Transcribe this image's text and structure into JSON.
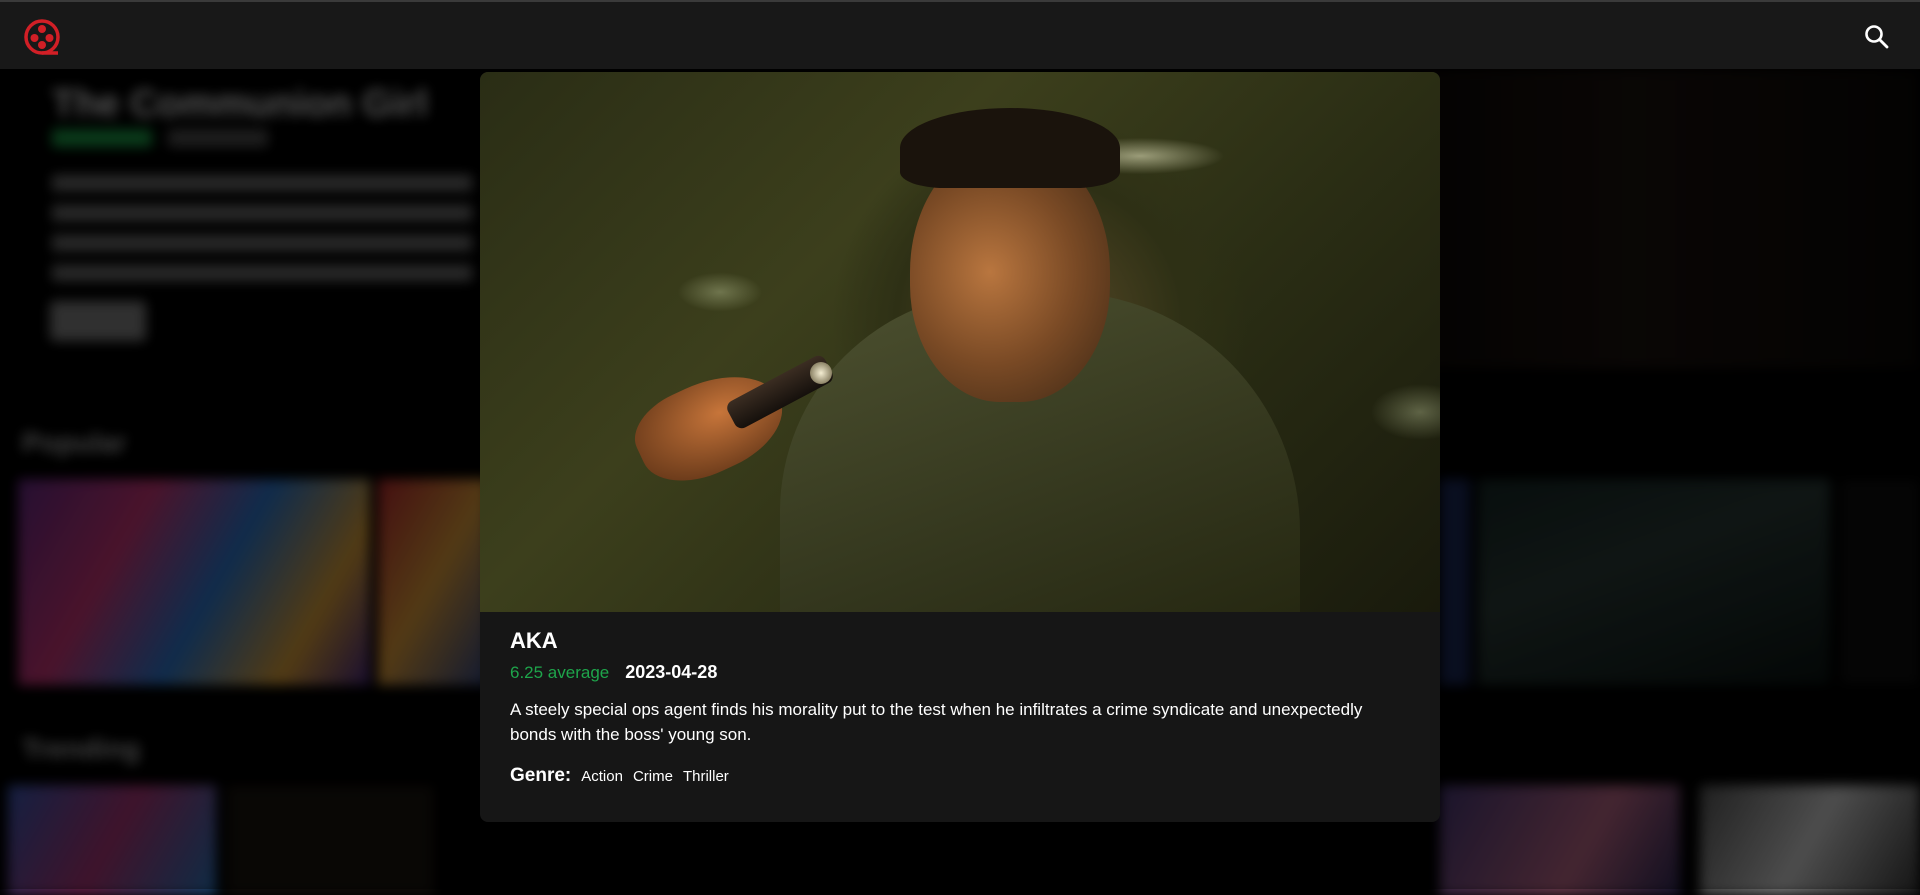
{
  "header": {
    "logo_icon": "film-reel-logo-icon",
    "search_icon": "search-icon",
    "accent_color": "#d21f26"
  },
  "modal": {
    "title": "AKA",
    "rating_text": "6.25 average",
    "release_date": "2023-04-28",
    "overview": "A steely special ops agent finds his morality put to the test when he infiltrates a crime syndicate and unexpectedly bonds with the boss' young son.",
    "genre_label": "Genre:",
    "genres": [
      "Action",
      "Crime",
      "Thriller"
    ],
    "rating_color": "#1ea54b"
  },
  "background": {
    "hero_title": "The Communion Girl",
    "rows": [
      {
        "title": "Popular"
      },
      {
        "title": "Trending"
      }
    ]
  }
}
